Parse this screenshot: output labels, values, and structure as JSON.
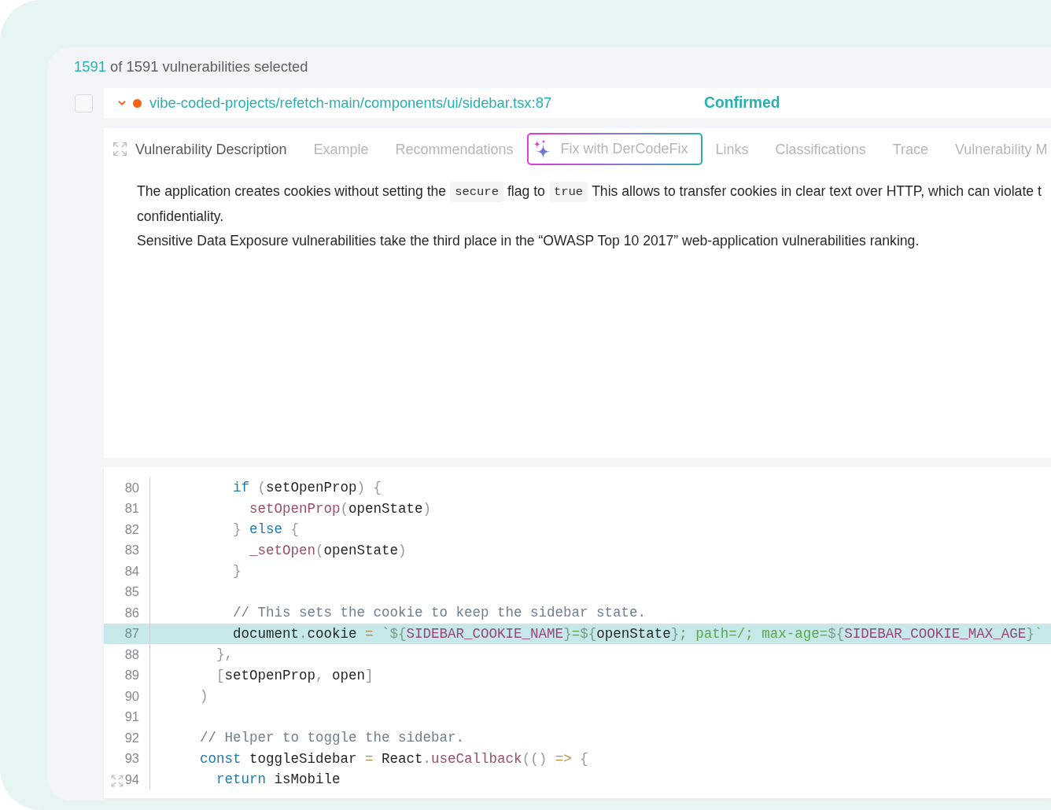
{
  "selection": {
    "selected": "1591",
    "text": "of 1591 vulnerabilities selected"
  },
  "finding": {
    "checked": false,
    "expanded": true,
    "color": "#f0621a",
    "path": "vibe-coded-projects/refetch-main/components/ui/sidebar.tsx:87",
    "status": "Confirmed"
  },
  "tabs": [
    {
      "kind": "tab",
      "label": "Vulnerability Description",
      "selected": true
    },
    {
      "kind": "tab",
      "label": "Example",
      "selected": false
    },
    {
      "kind": "tab",
      "label": "Recommendations",
      "selected": false
    },
    {
      "kind": "ai-button",
      "label": "Fix with DerCodeFix",
      "selected": false
    },
    {
      "kind": "tab",
      "label": "Links",
      "selected": false
    },
    {
      "kind": "tab",
      "label": "Classifications",
      "selected": false
    },
    {
      "kind": "tab",
      "label": "Trace",
      "selected": false
    },
    {
      "kind": "tab",
      "label": "Vulnerability M",
      "selected": false
    }
  ],
  "description": {
    "lines": [
      [
        {
          "kind": "text",
          "text": "The application creates cookies without setting the"
        },
        {
          "kind": "code",
          "text": "secure"
        },
        {
          "kind": "text",
          "text": "flag to"
        },
        {
          "kind": "code",
          "text": "true"
        },
        {
          "kind": "text",
          "text": "This allows to transfer cookies in clear text over HTTP, which can violate t"
        }
      ],
      [
        {
          "kind": "text",
          "text": "confidentiality."
        }
      ],
      [
        {
          "kind": "text",
          "text": "Sensitive Data Exposure vulnerabilities take the third place in the “OWASP Top 10 2017” web-application vulnerabilities ranking."
        }
      ]
    ]
  },
  "code": {
    "lines": [
      {
        "number": "80",
        "highlighted": false,
        "tokens": [
          {
            "kind": "kw",
            "text": "        if"
          },
          {
            "kind": "punct",
            "text": " ("
          },
          {
            "kind": "plain",
            "text": "setOpenProp"
          },
          {
            "kind": "punct",
            "text": ")"
          },
          {
            "kind": "punct",
            "text": " {"
          }
        ]
      },
      {
        "number": "81",
        "highlighted": false,
        "tokens": [
          {
            "kind": "call",
            "text": "          setOpenProp"
          },
          {
            "kind": "punct",
            "text": "("
          },
          {
            "kind": "plain",
            "text": "openState"
          },
          {
            "kind": "punct",
            "text": ")"
          }
        ]
      },
      {
        "number": "82",
        "highlighted": false,
        "tokens": [
          {
            "kind": "punct",
            "text": "        }"
          },
          {
            "kind": "kw",
            "text": " else"
          },
          {
            "kind": "punct",
            "text": " {"
          }
        ]
      },
      {
        "number": "83",
        "highlighted": false,
        "tokens": [
          {
            "kind": "call",
            "text": "          _setOpen"
          },
          {
            "kind": "punct",
            "text": "("
          },
          {
            "kind": "plain",
            "text": "openState"
          },
          {
            "kind": "punct",
            "text": ")"
          }
        ]
      },
      {
        "number": "84",
        "highlighted": false,
        "tokens": [
          {
            "kind": "punct",
            "text": "        }"
          }
        ]
      },
      {
        "number": "85",
        "highlighted": false
      },
      {
        "number": "86",
        "highlighted": false,
        "tokens": [
          {
            "kind": "comment",
            "text": "        // This sets the cookie to keep the sidebar state."
          }
        ]
      },
      {
        "number": "87",
        "highlighted": true,
        "tokens": [
          {
            "kind": "plain",
            "text": "        document"
          },
          {
            "kind": "dot",
            "text": "."
          },
          {
            "kind": "plain",
            "text": "cookie "
          },
          {
            "kind": "op",
            "text": "="
          },
          {
            "kind": "str",
            "text": " `"
          },
          {
            "kind": "interp",
            "text": "${"
          },
          {
            "kind": "const",
            "text": "SIDEBAR_COOKIE_NAME"
          },
          {
            "kind": "interp",
            "text": "}"
          },
          {
            "kind": "str",
            "text": "="
          },
          {
            "kind": "interp",
            "text": "${"
          },
          {
            "kind": "plain",
            "text": "openState"
          },
          {
            "kind": "interp",
            "text": "}"
          },
          {
            "kind": "str",
            "text": "; path=/; max-age="
          },
          {
            "kind": "interp",
            "text": "${"
          },
          {
            "kind": "const",
            "text": "SIDEBAR_COOKIE_MAX_AGE"
          },
          {
            "kind": "interp",
            "text": "}"
          },
          {
            "kind": "str",
            "text": "`"
          }
        ]
      },
      {
        "number": "88",
        "highlighted": false,
        "tokens": [
          {
            "kind": "punct",
            "text": "      },"
          }
        ]
      },
      {
        "number": "89",
        "highlighted": false,
        "tokens": [
          {
            "kind": "punct",
            "text": "      ["
          },
          {
            "kind": "plain",
            "text": "setOpenProp"
          },
          {
            "kind": "punct",
            "text": ","
          },
          {
            "kind": "plain",
            "text": " open"
          },
          {
            "kind": "punct",
            "text": "]"
          }
        ]
      },
      {
        "number": "90",
        "highlighted": false,
        "tokens": [
          {
            "kind": "punct",
            "text": "    )"
          }
        ]
      },
      {
        "number": "91",
        "highlighted": false
      },
      {
        "number": "92",
        "highlighted": false,
        "tokens": [
          {
            "kind": "comment",
            "text": "    // Helper to toggle the sidebar."
          }
        ]
      },
      {
        "number": "93",
        "highlighted": false,
        "tokens": [
          {
            "kind": "kw",
            "text": "    const"
          },
          {
            "kind": "plain",
            "text": " toggleSidebar "
          },
          {
            "kind": "op",
            "text": "="
          },
          {
            "kind": "plain",
            "text": " React"
          },
          {
            "kind": "dot",
            "text": "."
          },
          {
            "kind": "call",
            "text": "useCallback"
          },
          {
            "kind": "punct",
            "text": "(()"
          },
          {
            "kind": "op",
            "text": " =>"
          },
          {
            "kind": "punct",
            "text": " {"
          }
        ]
      },
      {
        "number": "94",
        "highlighted": false,
        "tokens": [
          {
            "kind": "kw",
            "text": "      return"
          },
          {
            "kind": "plain",
            "text": " isMobile"
          }
        ]
      }
    ]
  }
}
